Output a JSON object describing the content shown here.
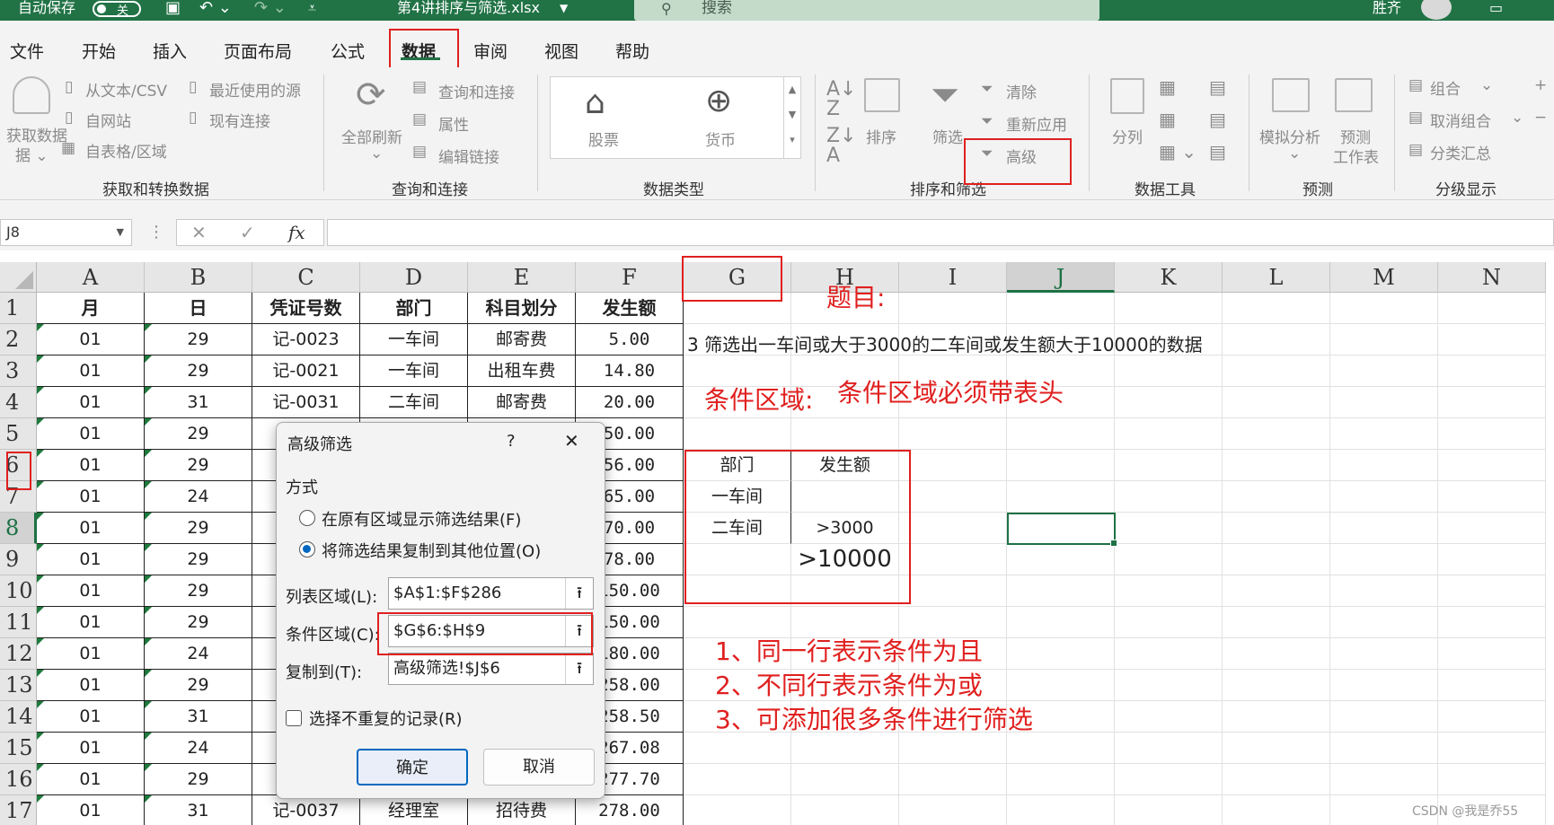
{
  "titlebar": {
    "autosave_label": "自动保存",
    "autosave_state": "关",
    "filename": "第4讲排序与筛选.xlsx",
    "search_placeholder": "搜索",
    "user": "胜齐"
  },
  "ribbon_tabs": [
    "文件",
    "开始",
    "插入",
    "页面布局",
    "公式",
    "数据",
    "审阅",
    "视图",
    "帮助"
  ],
  "ribbon": {
    "get_transform": {
      "get_data": "获取数据",
      "from_text": "从文本/CSV",
      "from_web": "自网站",
      "from_table": "自表格/区域",
      "recent_sources": "最近使用的源",
      "existing_connections": "现有连接",
      "group_label": "获取和转换数据"
    },
    "queries": {
      "refresh_all": "全部刷新",
      "queries_connections": "查询和连接",
      "properties": "属性",
      "edit_links": "编辑链接",
      "group_label": "查询和连接"
    },
    "data_types": {
      "stocks": "股票",
      "currency": "货币",
      "group_label": "数据类型"
    },
    "sort_filter": {
      "sort": "排序",
      "filter": "筛选",
      "clear": "清除",
      "reapply": "重新应用",
      "advanced": "高级",
      "group_label": "排序和筛选"
    },
    "data_tools": {
      "text_to_columns": "分列",
      "group_label": "数据工具"
    },
    "forecast": {
      "what_if": "模拟分析",
      "forecast_sheet_1": "预测",
      "forecast_sheet_2": "工作表",
      "group_label": "预测"
    },
    "outline": {
      "group": "组合",
      "ungroup": "取消组合",
      "subtotal": "分类汇总",
      "group_label": "分级显示"
    }
  },
  "formula_bar": {
    "name_box": "J8",
    "fx": "fx",
    "cancel": "✕",
    "confirm": "✓",
    "value": ""
  },
  "columns": [
    "A",
    "B",
    "C",
    "D",
    "E",
    "F",
    "G",
    "H",
    "I",
    "J",
    "K",
    "L",
    "M",
    "N"
  ],
  "rows": [
    "1",
    "2",
    "3",
    "4",
    "5",
    "6",
    "7",
    "8",
    "9",
    "10",
    "11",
    "12",
    "13",
    "14",
    "15",
    "16",
    "17"
  ],
  "table": {
    "headers": [
      "月",
      "日",
      "凭证号数",
      "部门",
      "科目划分",
      "发生额"
    ],
    "rows": [
      [
        "01",
        "29",
        "记-0023",
        "一车间",
        "邮寄费",
        "5.00"
      ],
      [
        "01",
        "29",
        "记-0021",
        "一车间",
        "出租车费",
        "14.80"
      ],
      [
        "01",
        "31",
        "记-0031",
        "二车间",
        "邮寄费",
        "20.00"
      ],
      [
        "01",
        "29",
        "",
        "",
        "",
        "50.00"
      ],
      [
        "01",
        "29",
        "",
        "",
        "",
        "56.00"
      ],
      [
        "01",
        "24",
        "",
        "",
        "",
        "65.00"
      ],
      [
        "01",
        "29",
        "",
        "",
        "",
        "70.00"
      ],
      [
        "01",
        "29",
        "",
        "",
        "",
        "78.00"
      ],
      [
        "01",
        "29",
        "",
        "",
        "",
        "150.00"
      ],
      [
        "01",
        "29",
        "",
        "",
        "",
        "150.00"
      ],
      [
        "01",
        "24",
        "",
        "",
        "",
        "180.00"
      ],
      [
        "01",
        "29",
        "",
        "",
        "",
        "258.00"
      ],
      [
        "01",
        "31",
        "",
        "",
        "",
        "258.50"
      ],
      [
        "01",
        "24",
        "",
        "",
        "",
        "267.08"
      ],
      [
        "01",
        "29",
        "",
        "",
        "",
        "277.70"
      ],
      [
        "01",
        "31",
        "记-0037",
        "经理室",
        "招待费",
        "278.00"
      ]
    ]
  },
  "criteria": {
    "headers": [
      "部门",
      "发生额"
    ],
    "row1": [
      "一车间",
      ""
    ],
    "row2": [
      "二车间",
      ">3000"
    ],
    "row3": [
      "",
      ">10000"
    ]
  },
  "annotations": {
    "title": "题目:",
    "task": "3  筛选出一车间或大于3000的二车间或发生额大于10000的数据",
    "criteria_label": "条件区域:",
    "criteria_note": "条件区域必须带表头",
    "rule1": "1、同一行表示条件为且",
    "rule2": "2、不同行表示条件为或",
    "rule3": "3、可添加很多条件进行筛选"
  },
  "dialog": {
    "title": "高级筛选",
    "help": "?",
    "close": "✕",
    "mode_label": "方式",
    "option1": "在原有区域显示筛选结果(F)",
    "option2": "将筛选结果复制到其他位置(O)",
    "list_range_label": "列表区域(L):",
    "list_range_value": "$A$1:$F$286",
    "criteria_range_label": "条件区域(C):",
    "criteria_range_value": "$G$6:$H$9",
    "copy_to_label": "复制到(T):",
    "copy_to_value": "高级筛选!$J$6",
    "unique_label": "选择不重复的记录(R)",
    "ok": "确定",
    "cancel": "取消",
    "selected_option": 2
  },
  "watermark": "CSDN @我是乔55"
}
